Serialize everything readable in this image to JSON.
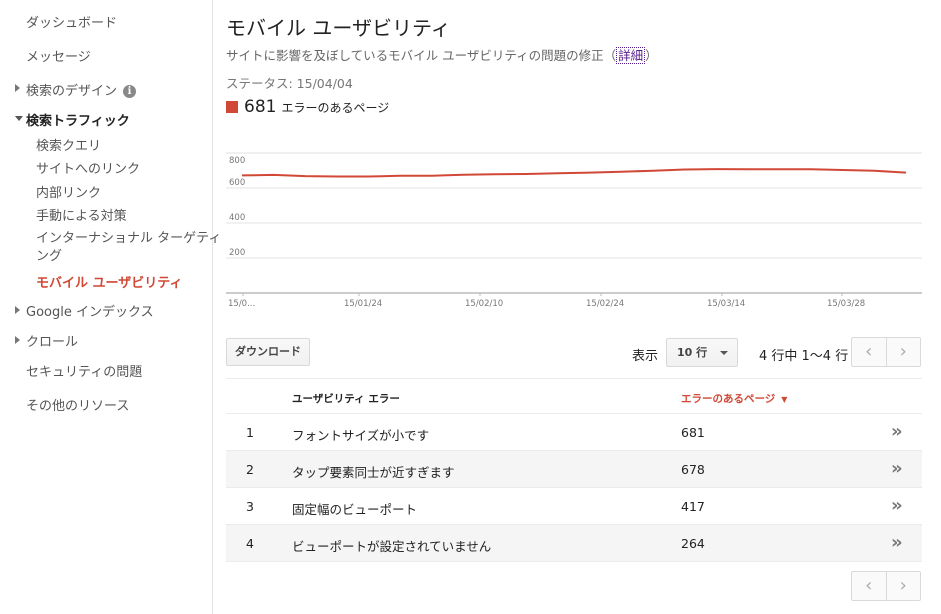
{
  "sidebar": {
    "items": [
      {
        "label": "ダッシュボード"
      },
      {
        "label": "メッセージ"
      },
      {
        "label": "検索のデザイン",
        "info_icon": "info-icon"
      },
      {
        "label": "検索トラフィック"
      },
      {
        "label": "検索クエリ"
      },
      {
        "label": "サイトへのリンク"
      },
      {
        "label": "内部リンク"
      },
      {
        "label": "手動による対策"
      },
      {
        "label_line1": "インターナショナル ターゲティ",
        "label_line2": "ング"
      },
      {
        "label": "モバイル ユーザビリティ"
      },
      {
        "label": "Google インデックス"
      },
      {
        "label": "クロール"
      },
      {
        "label": "セキュリティの問題"
      },
      {
        "label": "その他のリソース"
      }
    ]
  },
  "header": {
    "title": "モバイル ユーザビリティ",
    "subtitle": "サイトに影響を及ぼしているモバイル ユーザビリティの問題の修正（",
    "subtitle_link": "詳細",
    "subtitle_end": "）",
    "status": "ステータス: 15/04/04"
  },
  "summary": {
    "count": "681",
    "label": "エラーのあるページ",
    "color": "#d14836"
  },
  "chart_data": {
    "type": "line",
    "x": [
      "15/0...",
      "15/01/24",
      "15/02/10",
      "15/02/24",
      "15/03/14",
      "15/03/28"
    ],
    "series": [
      {
        "values": [
          672,
          675,
          668,
          666,
          666,
          670,
          670,
          676,
          678,
          680,
          684,
          688,
          693,
          698,
          706,
          708,
          707,
          707,
          707,
          703,
          698,
          688
        ]
      }
    ],
    "yticks": [
      "800",
      "600",
      "400",
      "200"
    ],
    "ylim": [
      0,
      800
    ],
    "grid": true,
    "line_color": "#d14836"
  },
  "controls": {
    "download": "ダウンロード",
    "show_label": "表示",
    "rows_value": "10 行",
    "range": "4 行中 1〜4 行",
    "prev_icon": "‹",
    "next_icon": "›"
  },
  "table": {
    "col_error": "ユーザビリティ エラー",
    "col_pages": "エラーのあるページ",
    "sort_icon": "▼",
    "rows": [
      {
        "idx": "1",
        "name": "フォントサイズが小です",
        "value": "681"
      },
      {
        "idx": "2",
        "name": "タップ要素同士が近すぎます",
        "value": "678"
      },
      {
        "idx": "3",
        "name": "固定幅のビューポート",
        "value": "417"
      },
      {
        "idx": "4",
        "name": "ビューポートが設定されていません",
        "value": "264"
      }
    ],
    "go_icon": "»"
  }
}
